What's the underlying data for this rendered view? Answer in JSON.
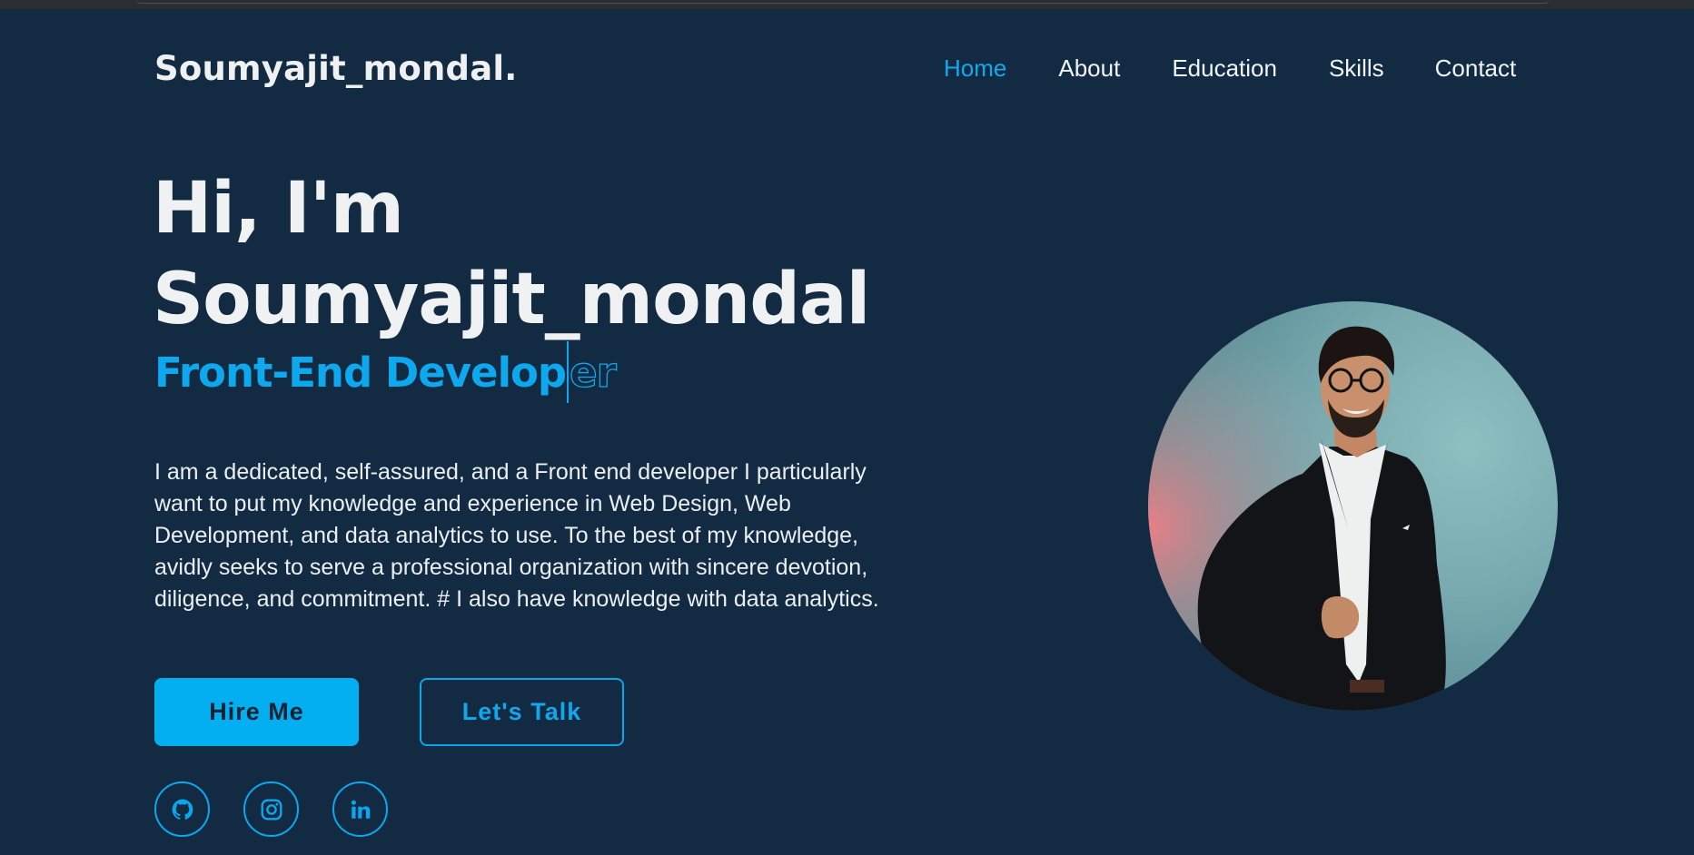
{
  "header": {
    "logo": "Soumyajit_mondal.",
    "nav": [
      {
        "label": "Home",
        "active": true
      },
      {
        "label": "About",
        "active": false
      },
      {
        "label": "Education",
        "active": false
      },
      {
        "label": "Skills",
        "active": false
      },
      {
        "label": "Contact",
        "active": false
      }
    ]
  },
  "hero": {
    "greeting": "Hi, I'm",
    "name": "Soumyajit_mondal",
    "role_typed": "Front-End Develop",
    "role_tail": "er",
    "bio": "I am a dedicated, self-assured, and a Front end developer I particularly want to put my knowledge and experience in Web Design, Web Development, and data analytics to use. To the best of my knowledge, avidly seeks to serve a professional organization with sincere devotion, diligence, and commitment. # I also have knowledge with data analytics.",
    "buttons": {
      "hire": "Hire Me",
      "talk": "Let's Talk"
    },
    "socials": [
      {
        "icon": "github-icon"
      },
      {
        "icon": "instagram-icon"
      },
      {
        "icon": "linkedin-icon"
      }
    ],
    "avatar_icon": "profile-photo"
  },
  "colors": {
    "background": "#122b42",
    "accent": "#0ea8ee",
    "text": "#f0f1f3"
  }
}
